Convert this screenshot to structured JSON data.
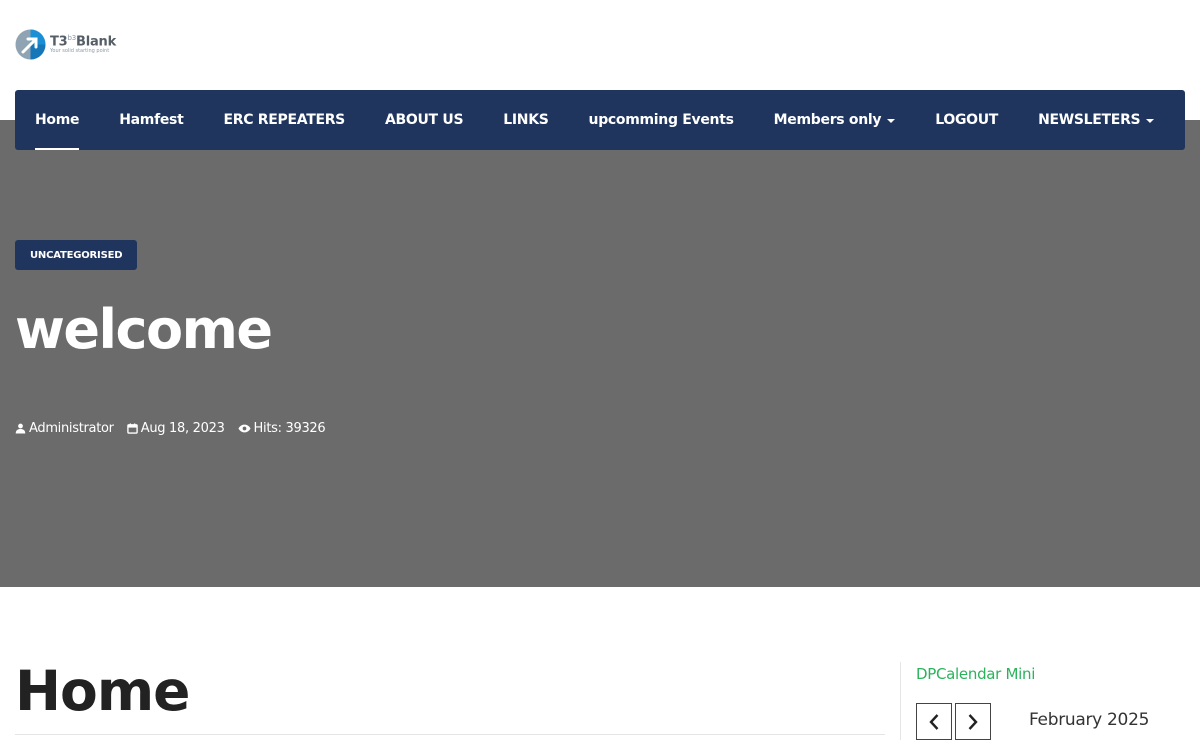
{
  "logo": {
    "name": "T3",
    "superscript": "b3",
    "name_suffix": "Blank",
    "tagline": "Your solid starting point"
  },
  "nav": {
    "items": [
      {
        "label": "Home",
        "active": true,
        "dropdown": false
      },
      {
        "label": "Hamfest",
        "active": false,
        "dropdown": false
      },
      {
        "label": "ERC REPEATERS",
        "active": false,
        "dropdown": false
      },
      {
        "label": "ABOUT US",
        "active": false,
        "dropdown": false
      },
      {
        "label": "LINKS",
        "active": false,
        "dropdown": false
      },
      {
        "label": "upcomming Events",
        "active": false,
        "dropdown": false
      },
      {
        "label": "Members only",
        "active": false,
        "dropdown": true
      },
      {
        "label": "LOGOUT",
        "active": false,
        "dropdown": false
      },
      {
        "label": "NEWSLETERS",
        "active": false,
        "dropdown": true
      }
    ]
  },
  "hero": {
    "category": "UNCATEGORISED",
    "title": "welcome",
    "author": "Administrator",
    "date": "Aug 18, 2023",
    "hits": "Hits: 39326"
  },
  "main": {
    "heading": "Home"
  },
  "sidebar": {
    "title": "DPCalendar Mini",
    "month": "February 2025"
  },
  "colors": {
    "nav_bg": "#1f355e",
    "hero_bg": "#6b6b6b",
    "sidebar_title": "#2ab35b"
  }
}
